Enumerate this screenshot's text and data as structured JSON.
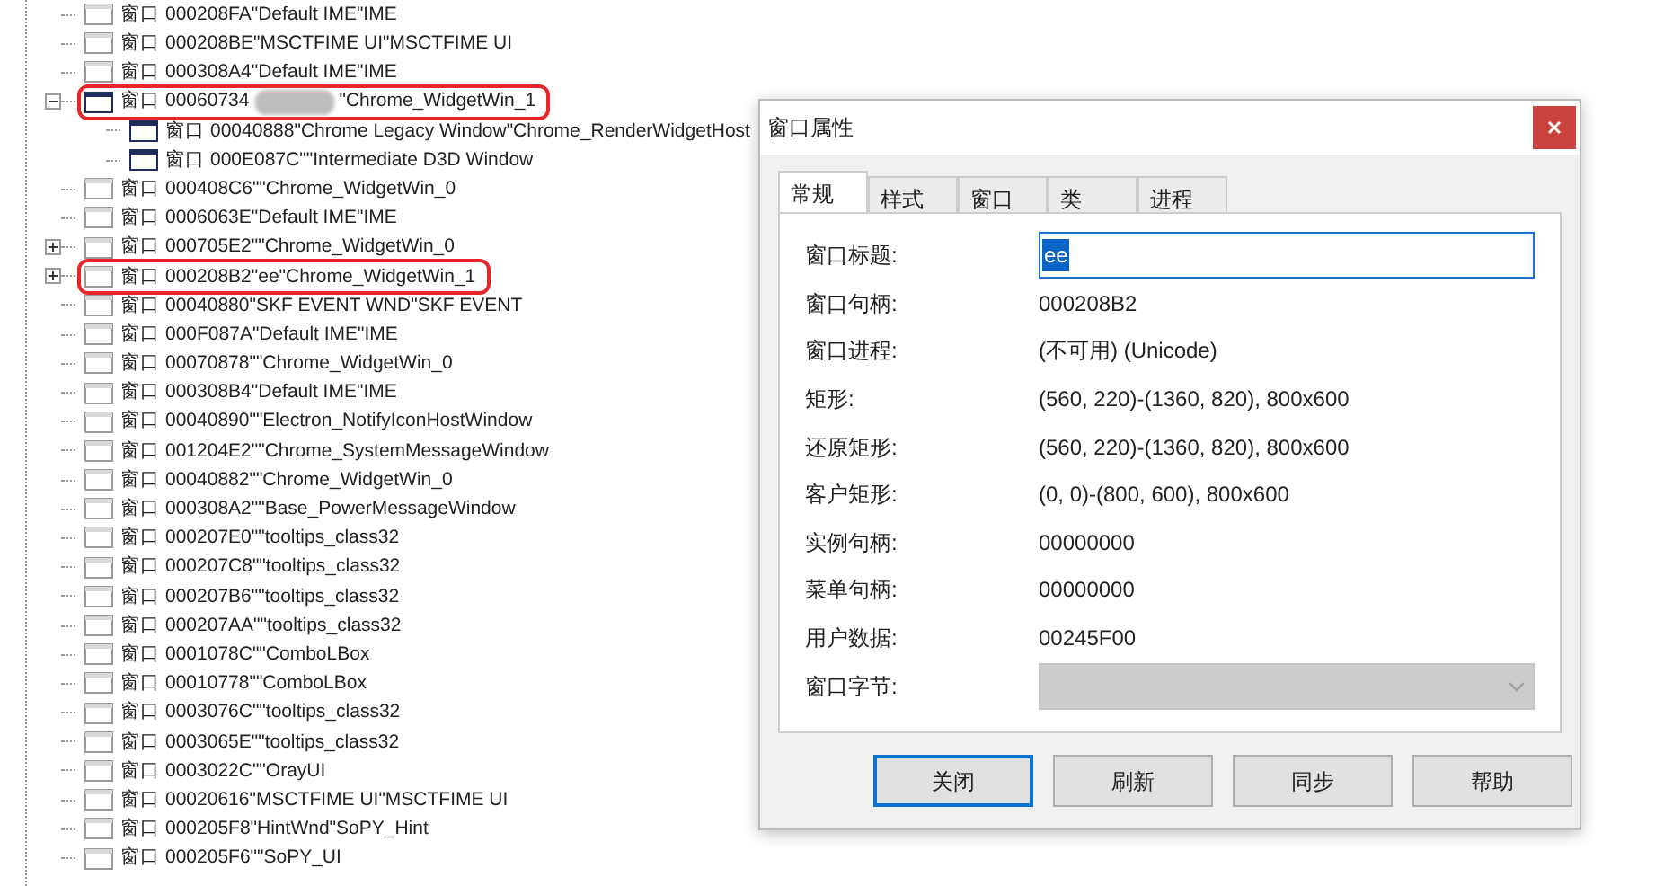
{
  "tree": [
    {
      "label": "窗口",
      "text": "000208FA\"Default IME\"IME",
      "highlighted": false,
      "expandable": false,
      "visible": false
    },
    {
      "label": "窗口",
      "text": "000208BE\"MSCTFIME UI\"MSCTFIME UI",
      "highlighted": false,
      "expandable": false,
      "visible": false
    },
    {
      "label": "窗口",
      "text": "000308A4\"Default IME\"IME",
      "highlighted": false,
      "expandable": false,
      "visible": false
    },
    {
      "label": "窗口",
      "text": "00060734",
      "redacted": true,
      "text_after": "\"Chrome_WidgetWin_1",
      "highlighted": true,
      "expandable": true,
      "expanded": true,
      "visible": true,
      "children": [
        {
          "label": "窗口",
          "text": "00040888\"Chrome Legacy Window\"Chrome_RenderWidgetHost",
          "visible": true
        },
        {
          "label": "窗口",
          "text": "000E087C\"\"Intermediate D3D Window",
          "visible": true
        }
      ]
    },
    {
      "label": "窗口",
      "text": "000408C6\"\"Chrome_WidgetWin_0",
      "highlighted": false,
      "expandable": false,
      "visible": false
    },
    {
      "label": "窗口",
      "text": "0006063E\"Default IME\"IME",
      "highlighted": false,
      "expandable": false,
      "visible": false
    },
    {
      "label": "窗口",
      "text": "000705E2\"\"Chrome_WidgetWin_0",
      "highlighted": false,
      "expandable": true,
      "expanded": false,
      "visible": false
    },
    {
      "label": "窗口",
      "text": "000208B2\"ee\"Chrome_WidgetWin_1",
      "highlighted": true,
      "expandable": true,
      "expanded": false,
      "visible": false
    },
    {
      "label": "窗口",
      "text": "00040880\"SKF EVENT WND\"SKF EVENT",
      "highlighted": false,
      "expandable": false,
      "visible": false
    },
    {
      "label": "窗口",
      "text": "000F087A\"Default IME\"IME",
      "highlighted": false,
      "expandable": false,
      "visible": false
    },
    {
      "label": "窗口",
      "text": "00070878\"\"Chrome_WidgetWin_0",
      "highlighted": false,
      "expandable": false,
      "visible": false
    },
    {
      "label": "窗口",
      "text": "000308B4\"Default IME\"IME",
      "highlighted": false,
      "expandable": false,
      "visible": false
    },
    {
      "label": "窗口",
      "text": "00040890\"\"Electron_NotifyIconHostWindow",
      "highlighted": false,
      "expandable": false,
      "visible": false
    },
    {
      "label": "窗口",
      "text": "001204E2\"\"Chrome_SystemMessageWindow",
      "highlighted": false,
      "expandable": false,
      "visible": false
    },
    {
      "label": "窗口",
      "text": "00040882\"\"Chrome_WidgetWin_0",
      "highlighted": false,
      "expandable": false,
      "visible": false
    },
    {
      "label": "窗口",
      "text": "000308A2\"\"Base_PowerMessageWindow",
      "highlighted": false,
      "expandable": false,
      "visible": false
    },
    {
      "label": "窗口",
      "text": "000207E0\"\"tooltips_class32",
      "highlighted": false,
      "expandable": false,
      "visible": false
    },
    {
      "label": "窗口",
      "text": "000207C8\"\"tooltips_class32",
      "highlighted": false,
      "expandable": false,
      "visible": false
    },
    {
      "label": "窗口",
      "text": "000207B6\"\"tooltips_class32",
      "highlighted": false,
      "expandable": false,
      "visible": false
    },
    {
      "label": "窗口",
      "text": "000207AA\"\"tooltips_class32",
      "highlighted": false,
      "expandable": false,
      "visible": false
    },
    {
      "label": "窗口",
      "text": "0001078C\"\"ComboLBox",
      "highlighted": false,
      "expandable": false,
      "visible": false
    },
    {
      "label": "窗口",
      "text": "00010778\"\"ComboLBox",
      "highlighted": false,
      "expandable": false,
      "visible": false
    },
    {
      "label": "窗口",
      "text": "0003076C\"\"tooltips_class32",
      "highlighted": false,
      "expandable": false,
      "visible": false
    },
    {
      "label": "窗口",
      "text": "0003065E\"\"tooltips_class32",
      "highlighted": false,
      "expandable": false,
      "visible": false
    },
    {
      "label": "窗口",
      "text": "0003022C\"\"OrayUI",
      "highlighted": false,
      "expandable": false,
      "visible": false
    },
    {
      "label": "窗口",
      "text": "00020616\"MSCTFIME UI\"MSCTFIME UI",
      "highlighted": false,
      "expandable": false,
      "visible": false
    },
    {
      "label": "窗口",
      "text": "000205F8\"HintWnd\"SoPY_Hint",
      "highlighted": false,
      "expandable": false,
      "visible": false
    },
    {
      "label": "窗口",
      "text": "000205F6\"\"SoPY_UI",
      "highlighted": false,
      "expandable": false,
      "visible": false
    }
  ],
  "dialog": {
    "title": "窗口属性",
    "tabs": [
      {
        "label": "常规",
        "selected": true
      },
      {
        "label": "样式",
        "selected": false
      },
      {
        "label": "窗口",
        "selected": false
      },
      {
        "label": "类",
        "selected": false
      },
      {
        "label": "进程",
        "selected": false
      }
    ],
    "fields": [
      {
        "kind": "input",
        "label": "窗口标题:",
        "value": "ee"
      },
      {
        "kind": "text",
        "label": "窗口句柄:",
        "value": "000208B2"
      },
      {
        "kind": "text",
        "label": "窗口进程:",
        "value": "(不可用) (Unicode)"
      },
      {
        "kind": "text",
        "label": "矩形:",
        "value": "(560, 220)-(1360, 820), 800x600"
      },
      {
        "kind": "text",
        "label": "还原矩形:",
        "value": "(560, 220)-(1360, 820), 800x600"
      },
      {
        "kind": "text",
        "label": "客户矩形:",
        "value": "(0, 0)-(800, 600), 800x600"
      },
      {
        "kind": "text",
        "label": "实例句柄:",
        "value": "00000000"
      },
      {
        "kind": "text",
        "label": "菜单句柄:",
        "value": "00000000"
      },
      {
        "kind": "text",
        "label": "用户数据:",
        "value": "00245F00"
      },
      {
        "kind": "select",
        "label": "窗口字节:",
        "disabled": true
      }
    ],
    "buttons": [
      {
        "label": "关闭",
        "default": true
      },
      {
        "label": "刷新",
        "default": false
      },
      {
        "label": "同步",
        "default": false
      },
      {
        "label": "帮助",
        "default": false
      }
    ]
  }
}
